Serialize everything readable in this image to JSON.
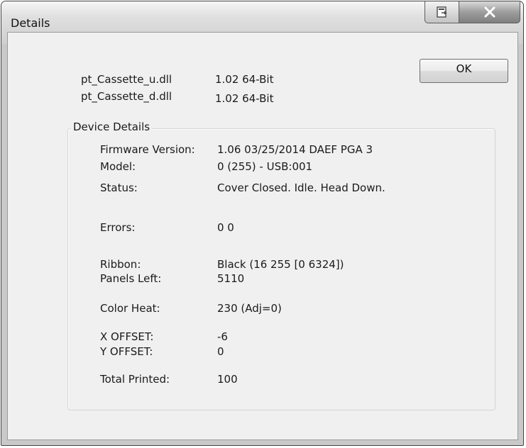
{
  "window": {
    "title": "Details"
  },
  "buttons": {
    "ok_label": "OK"
  },
  "dlls": [
    {
      "name": "pt_Cassette_u.dll",
      "version": "1.02  64-Bit"
    },
    {
      "name": "pt_Cassette_d.dll",
      "version": "1.02  64-Bit"
    }
  ],
  "device_details": {
    "group_label": "Device Details",
    "rows": [
      {
        "label": "Firmware Version:",
        "value": "1.06 03/25/2014  DAEF  PGA 3"
      },
      {
        "label": "Model:",
        "value": "0 (255) - USB:001"
      },
      {
        "label": "Status:",
        "value": "Cover Closed. Idle. Head Down."
      },
      {
        "label": "Errors:",
        "value": "0 0"
      },
      {
        "label": "Ribbon:",
        "value": "Black (16 255 [0 6324])"
      },
      {
        "label": "Panels Left:",
        "value": "5110"
      },
      {
        "label": "Color Heat:",
        "value": "230  (Adj=0)"
      },
      {
        "label": "X OFFSET:",
        "value": "-6"
      },
      {
        "label": "Y OFFSET:",
        "value": "0"
      },
      {
        "label": "Total Printed:",
        "value": "100"
      }
    ]
  },
  "icons": {
    "restore": "restore-window-icon",
    "close": "close-icon"
  },
  "colors": {
    "dialog_background": "#f0f0f0",
    "frame": "#c9c9c9",
    "close_button": "#9d9d9d"
  }
}
